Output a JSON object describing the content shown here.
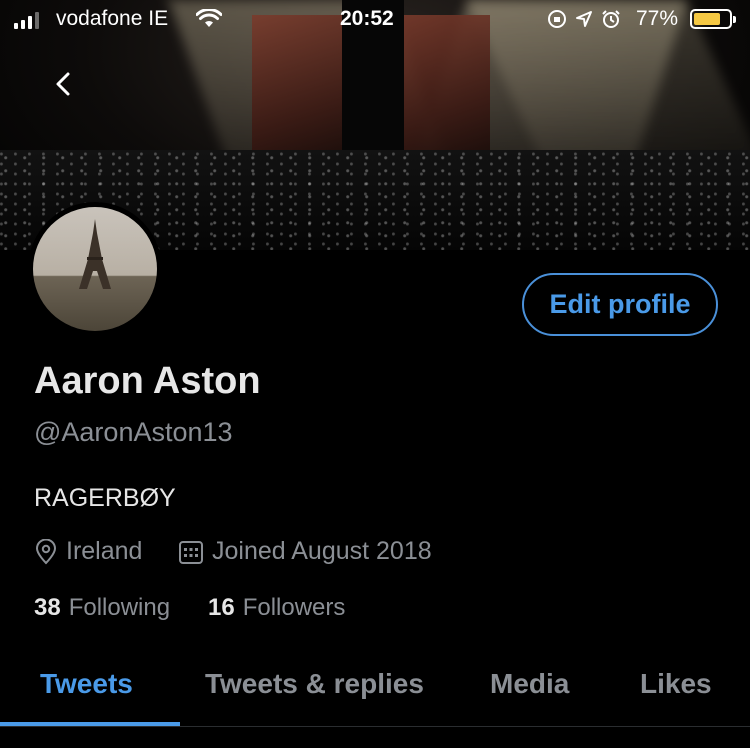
{
  "status_bar": {
    "carrier": "vodafone IE",
    "time": "20:52",
    "battery_percent": "77%",
    "battery_level": 0.77,
    "battery_color": "#f5c843"
  },
  "header": {
    "back_icon": "chevron-left-icon"
  },
  "profile": {
    "edit_label": "Edit profile",
    "name": "Aaron Aston",
    "handle": "@AaronAston13",
    "bio": "RAGERBØY",
    "location": "Ireland",
    "joined": "Joined August 2018",
    "following_count": "38",
    "following_label": "Following",
    "followers_count": "16",
    "followers_label": "Followers"
  },
  "tabs": [
    {
      "label": "Tweets",
      "active": true
    },
    {
      "label": "Tweets & replies",
      "active": false
    },
    {
      "label": "Media",
      "active": false
    },
    {
      "label": "Likes",
      "active": false
    }
  ],
  "colors": {
    "accent": "#4a9ae8",
    "background": "#000000",
    "secondary_text": "#8b8f95"
  }
}
